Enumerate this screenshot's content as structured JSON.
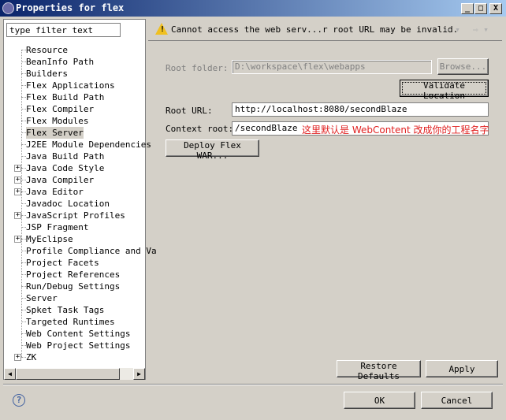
{
  "window": {
    "title": "Properties for flex",
    "min": "_",
    "max": "□",
    "close": "X"
  },
  "filter": {
    "value": "type filter text"
  },
  "tree": [
    {
      "label": "Resource",
      "expandable": false
    },
    {
      "label": "BeanInfo Path",
      "expandable": false
    },
    {
      "label": "Builders",
      "expandable": false
    },
    {
      "label": "Flex Applications",
      "expandable": false
    },
    {
      "label": "Flex Build Path",
      "expandable": false
    },
    {
      "label": "Flex Compiler",
      "expandable": false
    },
    {
      "label": "Flex Modules",
      "expandable": false
    },
    {
      "label": "Flex Server",
      "expandable": false,
      "selected": true
    },
    {
      "label": "J2EE Module Dependencies",
      "expandable": false
    },
    {
      "label": "Java Build Path",
      "expandable": false
    },
    {
      "label": "Java Code Style",
      "expandable": true
    },
    {
      "label": "Java Compiler",
      "expandable": true
    },
    {
      "label": "Java Editor",
      "expandable": true
    },
    {
      "label": "Javadoc Location",
      "expandable": false
    },
    {
      "label": "JavaScript Profiles",
      "expandable": true
    },
    {
      "label": "JSP Fragment",
      "expandable": false
    },
    {
      "label": "MyEclipse",
      "expandable": true
    },
    {
      "label": "Profile Compliance and Va",
      "expandable": false
    },
    {
      "label": "Project Facets",
      "expandable": false
    },
    {
      "label": "Project References",
      "expandable": false
    },
    {
      "label": "Run/Debug Settings",
      "expandable": false
    },
    {
      "label": "Server",
      "expandable": false
    },
    {
      "label": "Spket Task Tags",
      "expandable": false
    },
    {
      "label": "Targeted Runtimes",
      "expandable": false
    },
    {
      "label": "Web Content Settings",
      "expandable": false
    },
    {
      "label": "Web Project Settings",
      "expandable": false
    },
    {
      "label": "ZK",
      "expandable": true
    }
  ],
  "header": {
    "message": "Cannot access the web serv...r root URL may be invalid.",
    "icon": "warning-icon",
    "back": "⇦ ▾",
    "forward": "⇨ ▾"
  },
  "form": {
    "root_folder_label": "Root folder:",
    "root_folder_value": "D:\\workspace\\flex\\webapps",
    "browse": "Browse...",
    "validate": "Validate Location",
    "root_url_label": "Root URL:",
    "root_url_value": "http://localhost:8080/secondBlaze",
    "context_root_label": "Context root:",
    "context_root_value": "/secondBlaze",
    "annotation": "这里默认是 WebContent 改成你的工程名字",
    "deploy": "Deploy Flex WAR..."
  },
  "buttons": {
    "restore": "Restore Defaults",
    "apply": "Apply",
    "ok": "OK",
    "cancel": "Cancel",
    "help": "?"
  },
  "colors": {
    "annotation": "#e02020",
    "titlebar": "#0a246a"
  }
}
